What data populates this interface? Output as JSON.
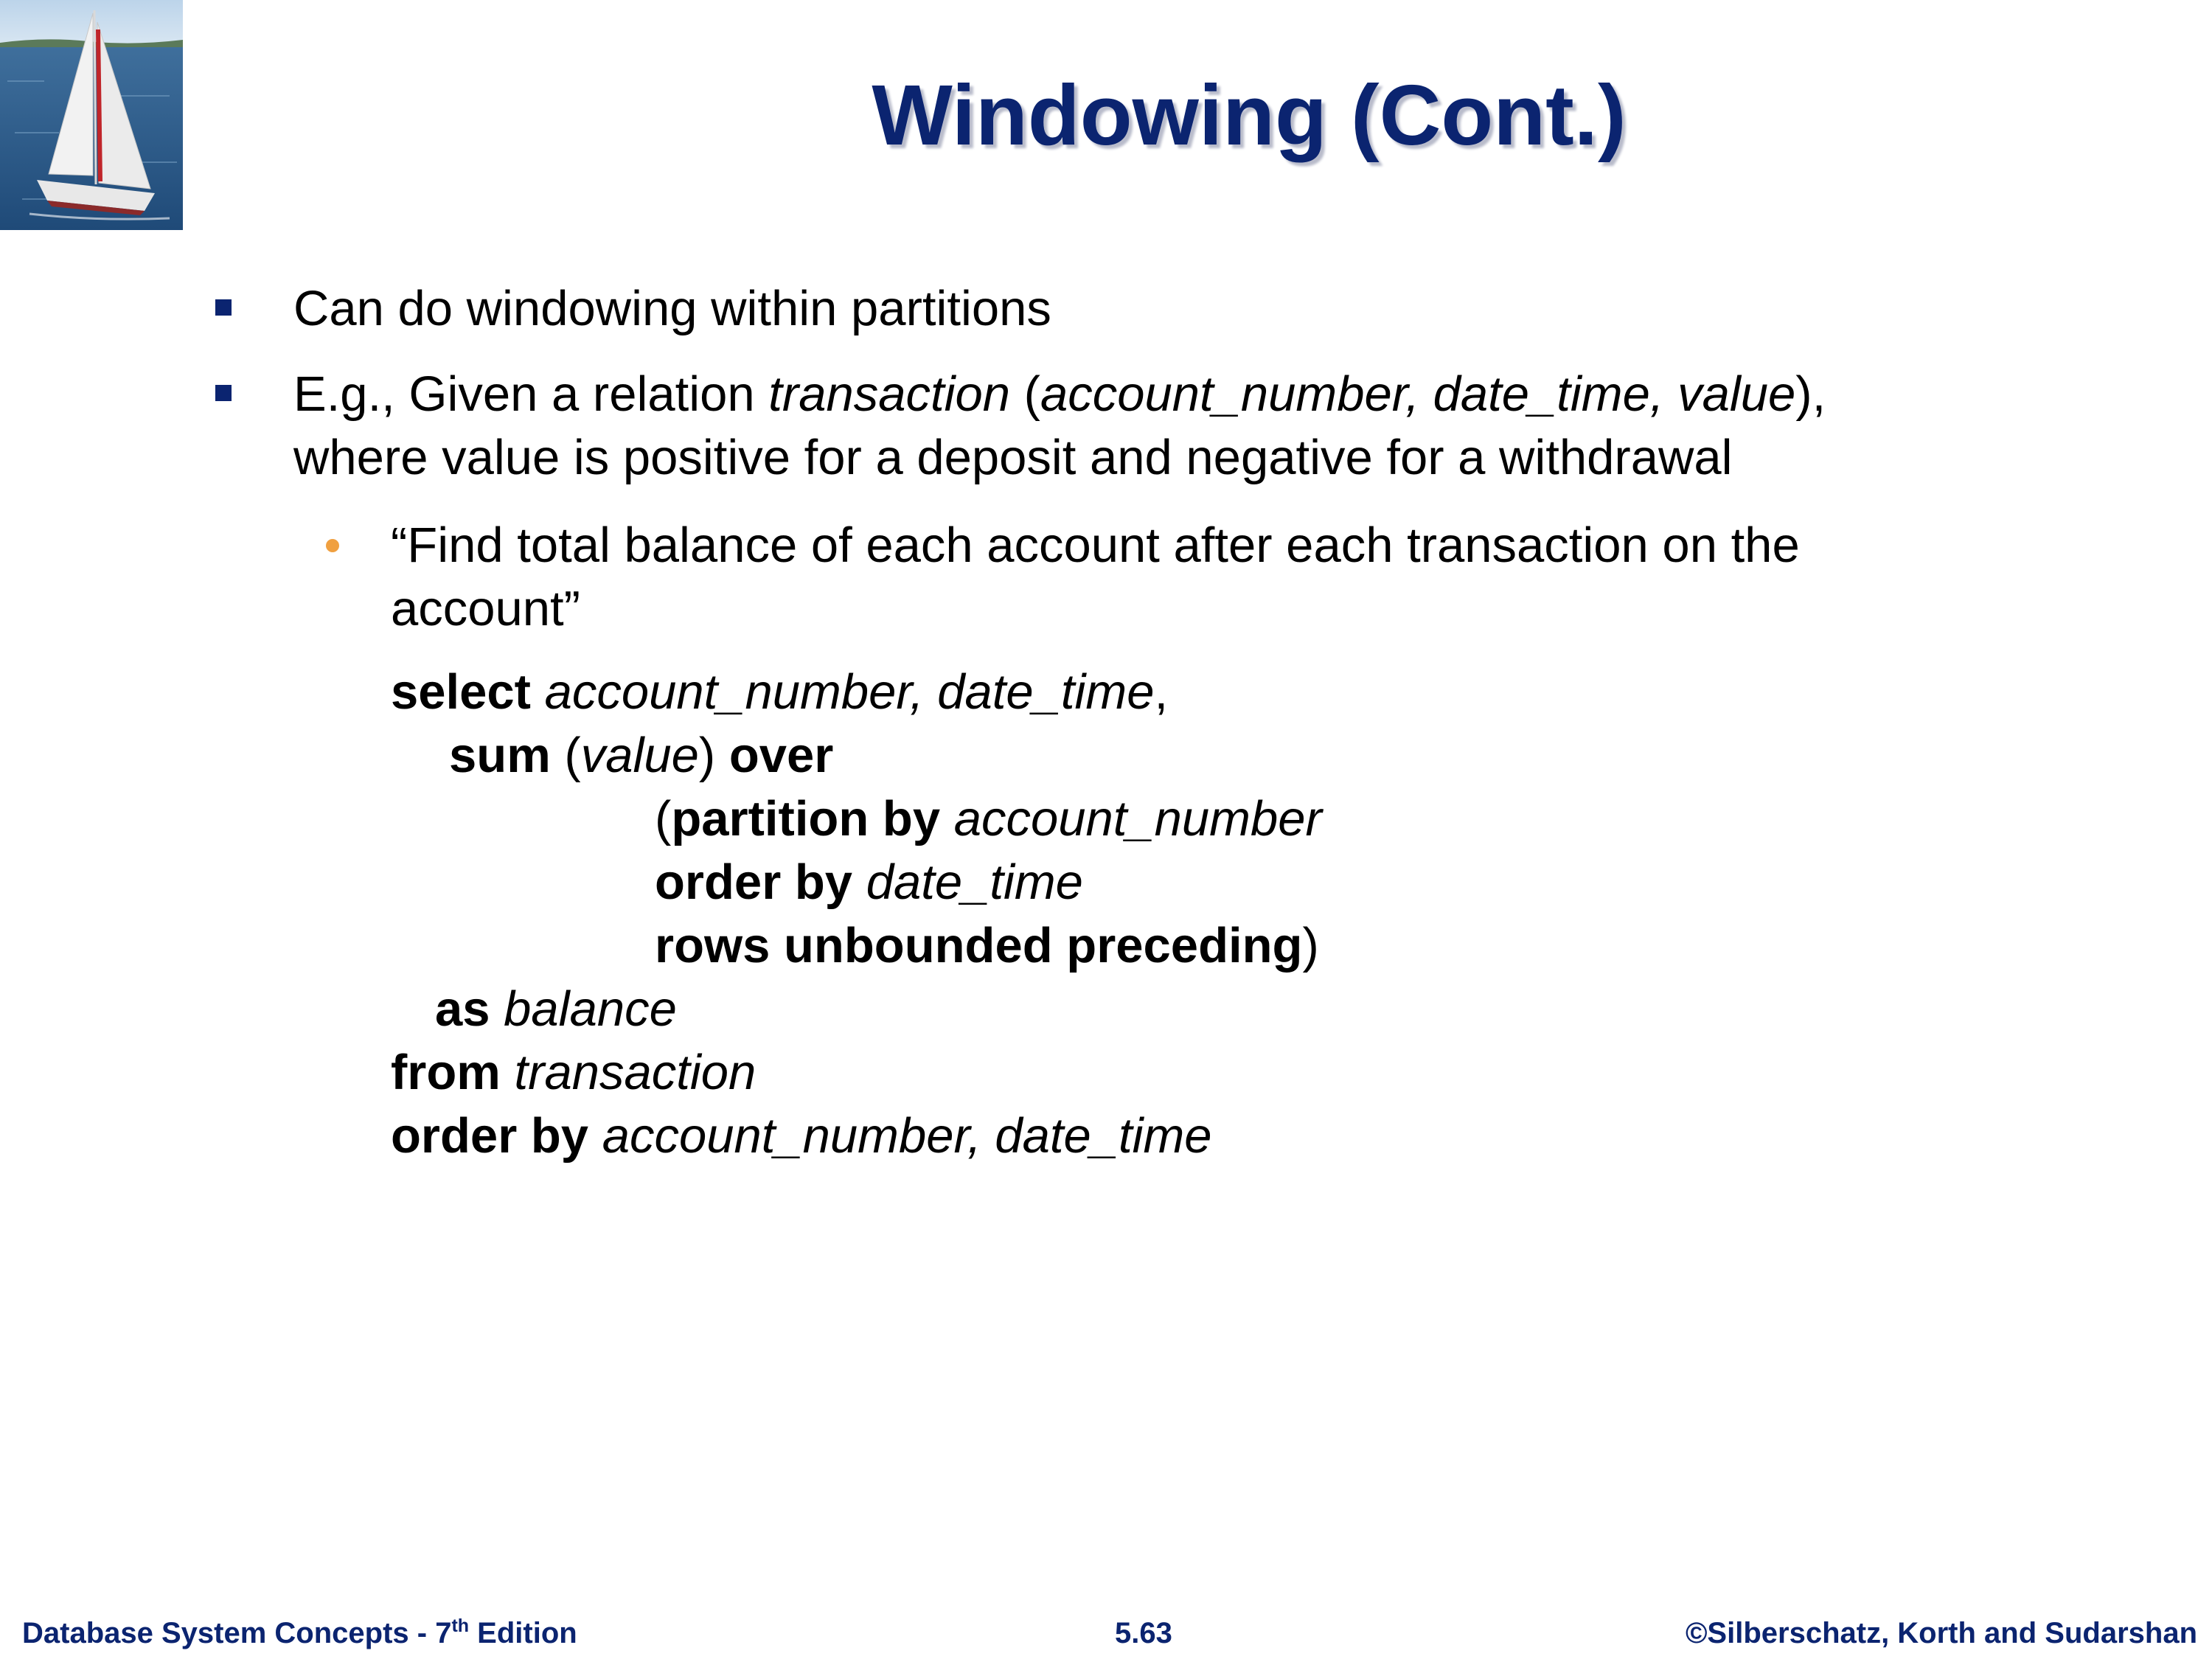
{
  "logo": {
    "icon": "sailboat-photo"
  },
  "title": "Windowing (Cont.)",
  "bullets": [
    {
      "text": "Can do windowing within partitions"
    },
    {
      "seg_a": "E.g., Given a relation ",
      "seg_b": "transaction",
      "seg_c": " (",
      "seg_d": "account_number, date_time, value",
      "seg_e": "),",
      "line2": "where value is positive for a deposit and negative for a withdrawal"
    }
  ],
  "subbullet": {
    "line1": "“Find total balance of each account after each transaction on the",
    "line2": "account”"
  },
  "query": {
    "l1_kw": "select",
    "l1_it": "account_number, date_time",
    "l1_end": ",",
    "l2_kw1": "sum",
    "l2_open": " (",
    "l2_it": "value",
    "l2_close": ") ",
    "l2_kw2": "over",
    "l3_open": "(",
    "l3_kw": "partition by",
    "l3_it": "account_number",
    "l4_kw": "order by",
    "l4_it": "date_time",
    "l5_kw": "rows unbounded preceding",
    "l5_close": ")",
    "l6_kw": "as",
    "l6_it": "balance",
    "l7_kw": "from",
    "l7_it": "transaction",
    "l8_kw": "order by",
    "l8_it": "account_number, date_time"
  },
  "footer": {
    "left_pre": "Database System Concepts - 7",
    "left_sup": "th",
    "left_post": " Edition",
    "center": "5.63",
    "right": "©Silberschatz, Korth and Sudarshan"
  },
  "colors": {
    "title": "#0b2470",
    "bullet_square": "#0b2470",
    "bullet_dot": "#f0a040",
    "footer": "#0b2470"
  }
}
